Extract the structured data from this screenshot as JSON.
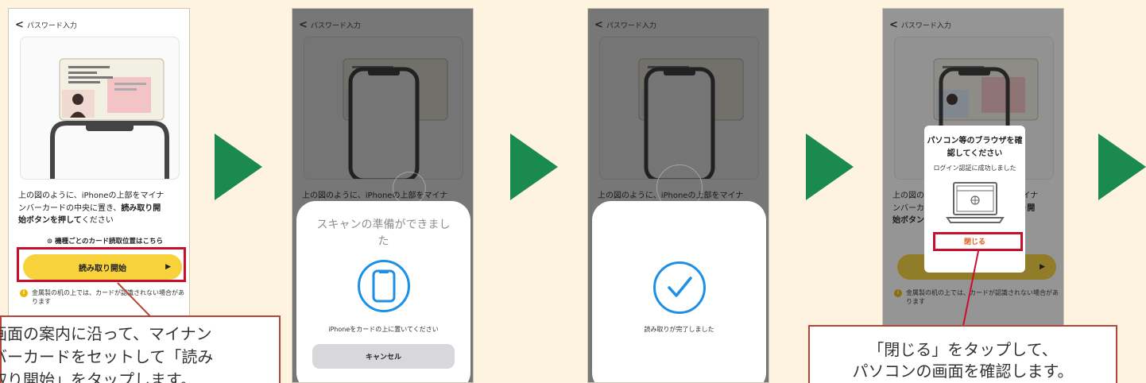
{
  "nav": {
    "back_label": "パスワード入力"
  },
  "instruction": {
    "line1": "上の図のように、iPhoneの上部をマイナ",
    "line2a": "ンバーカードの中央に置き、",
    "line2b": "読み取り開",
    "line3a": "始ボタンを押して",
    "line3b": "ください"
  },
  "card_position_link": "機種ごとのカード読取位置はこちら",
  "read_button": {
    "label": "読み取り開始",
    "arrow": "▶"
  },
  "note": "金属製の机の上では、カードが認識されない場合があります",
  "scan_sheet": {
    "title": "スキャンの準備ができました",
    "message": "iPhoneをカードの上に置いてください",
    "cancel_label": "キャンセル"
  },
  "done_sheet": {
    "message": "読み取りが完了しました"
  },
  "dialog": {
    "title_line1": "パソコン等のブラウザを確",
    "title_line2": "認してください",
    "subtitle": "ログイン認証に成功しました",
    "close_label": "閉じる"
  },
  "callouts": {
    "step1_line1": "画面の案内に沿って、マイナン",
    "step1_line2": "バーカードをセットして「読み",
    "step1_line3": "取り開始」をタップします。",
    "step4_line1": "「閉じる」をタップして、",
    "step4_line2": "パソコンの画面を確認します。"
  },
  "colors": {
    "background": "#fdf3de",
    "accent_yellow": "#f7d23b",
    "highlight_red": "#c8102e",
    "arrow_green": "#1b8a4f",
    "ios_blue": "#1d8fe6",
    "close_orange": "#e25b1d"
  }
}
